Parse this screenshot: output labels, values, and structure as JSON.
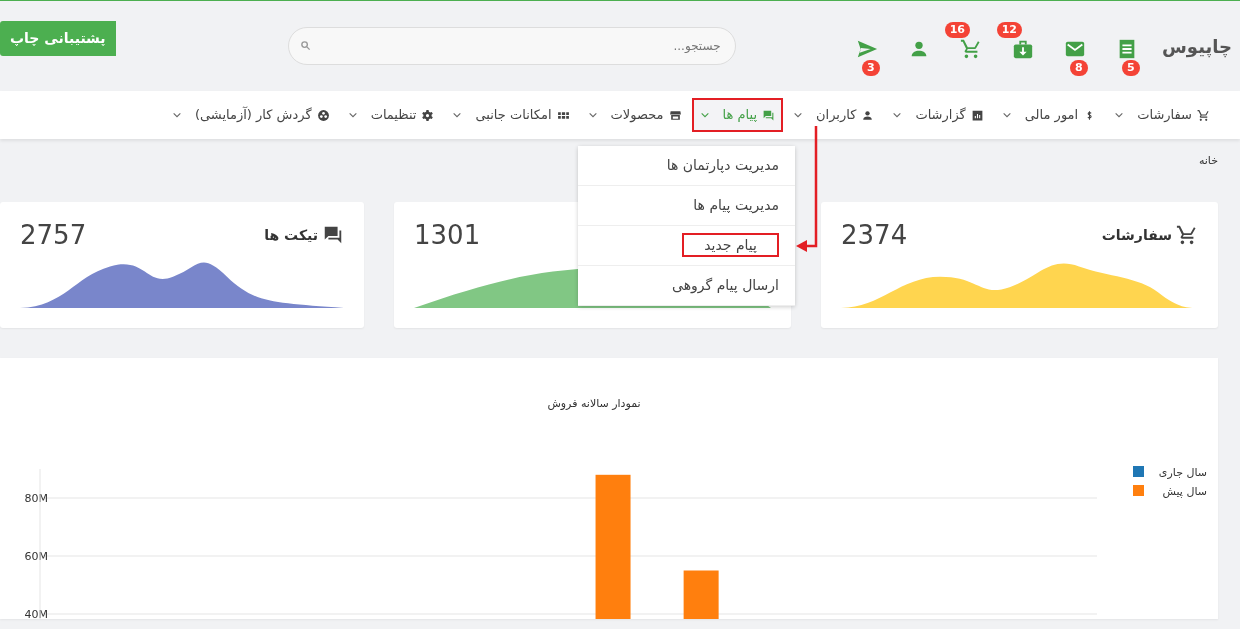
{
  "header": {
    "logo": "چاپیوس",
    "icons": [
      {
        "kind": "receipt",
        "badge": "5"
      },
      {
        "kind": "mail",
        "badge": "8"
      },
      {
        "kind": "bag",
        "badge": "12"
      },
      {
        "kind": "cart",
        "badge": "16"
      },
      {
        "kind": "person"
      },
      {
        "kind": "send",
        "badge": "3"
      }
    ],
    "search": {
      "placeholder": "جستجو..."
    },
    "support_button": "پشتیبانی چاپ"
  },
  "nav": [
    {
      "label": "سفارشات",
      "kind": "cart",
      "selected": false,
      "annotated": false
    },
    {
      "label": "امور مالی",
      "kind": "dollar",
      "selected": false,
      "annotated": false
    },
    {
      "label": "گزارشات",
      "kind": "chart",
      "selected": false,
      "annotated": false
    },
    {
      "label": "کاربران",
      "kind": "person",
      "selected": false,
      "annotated": false
    },
    {
      "label": "پیام ها",
      "kind": "chat",
      "selected": true,
      "annotated": true
    },
    {
      "label": "محصولات",
      "kind": "store",
      "selected": false,
      "annotated": false
    },
    {
      "label": "امکانات جانبی",
      "kind": "grid",
      "selected": false,
      "annotated": false
    },
    {
      "label": "تنظیمات",
      "kind": "gear",
      "selected": false,
      "annotated": false
    },
    {
      "label": "گردش کار (آزمایشی)",
      "kind": "ball",
      "selected": false,
      "annotated": false
    }
  ],
  "dropdown": [
    {
      "label": "مدیریت دپارتمان ها",
      "annotated": false
    },
    {
      "label": "مدیریت پیام ها",
      "annotated": false
    },
    {
      "label": "پیام جدید",
      "annotated": true
    },
    {
      "label": "ارسال پیام گروهی",
      "annotated": false
    }
  ],
  "breadcrumb": "خانه",
  "stats": [
    {
      "title": "سفارشات",
      "kind": "cart",
      "value": "2374",
      "color": "#ffd54f"
    },
    {
      "value": "1301",
      "color": "#81c784"
    },
    {
      "title": "تیکت ها",
      "kind": "chat",
      "value": "2757",
      "color": "#7986cb"
    }
  ],
  "sales_chart": {
    "chart_data": {
      "type": "bar",
      "title": "نمودار سالانه فروش",
      "grid": true,
      "ylim": [
        0,
        90
      ],
      "yticks": [
        {
          "value": 40,
          "label": "40M"
        },
        {
          "value": 60,
          "label": "60M"
        },
        {
          "value": 80,
          "label": "80M"
        }
      ],
      "series": [
        {
          "name": "سال جاری",
          "color": "#1f77b4",
          "values": [
            null,
            null,
            null,
            null,
            null,
            null,
            null,
            null,
            null,
            null,
            null,
            null
          ]
        },
        {
          "name": "سال پیش",
          "color": "#ff7f0e",
          "values": [
            null,
            null,
            null,
            null,
            null,
            null,
            88,
            55,
            null,
            null,
            null,
            null
          ]
        }
      ]
    }
  }
}
